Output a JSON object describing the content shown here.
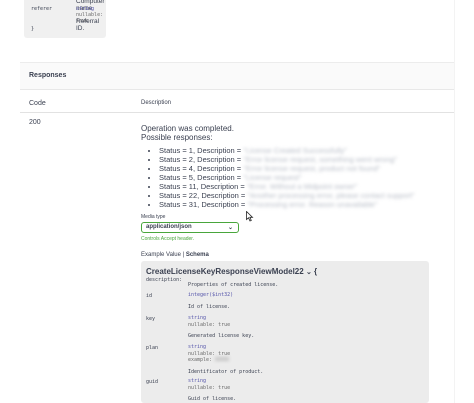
{
  "top_fragment": {
    "line1": "Computer name.",
    "key2": "referer",
    "type2": "string",
    "nullable2": "nullable: true",
    "desc2": "Referral ID.",
    "closing": "}"
  },
  "responses": {
    "section_title": "Responses",
    "col_code": "Code",
    "col_description": "Description",
    "code": "200",
    "desc_line1": "Operation was completed.",
    "desc_line2": "Possible responses:",
    "statuses": [
      {
        "label": "Status = 1, Description = ",
        "hidden": "\"License Created Successfully\""
      },
      {
        "label": "Status = 2, Description = ",
        "hidden": "\"Error license request, something went wrong\""
      },
      {
        "label": "Status = 4, Description = ",
        "hidden": "\"Error license request, product not found\""
      },
      {
        "label": "Status = 5, Description = ",
        "hidden": "\"License request\""
      },
      {
        "label": "Status = 11, Description = ",
        "hidden": "\"Error. Without a Midpoint owner\""
      },
      {
        "label": "Status = 22, Description = ",
        "hidden": "\"Another processing error, please contact support\""
      },
      {
        "label": "Status = 31, Description = ",
        "hidden": "\"Processing error. Reason unavailable\""
      }
    ],
    "media_type_label": "Media type",
    "media_type_value": "application/json",
    "controls_accept": "Controls Accept header.",
    "example_value_tab": "Example Value",
    "tab_separator": "|",
    "schema_tab": "Schema"
  },
  "schema": {
    "model_name": "CreateLicenseKeyResponseViewModel22",
    "open_brace": "{",
    "description_key": "description:",
    "description_val": "Properties of created license.",
    "fields": [
      {
        "key": "id",
        "type": "integer($int32)",
        "nullable": "",
        "example": "",
        "desc": "Id of license."
      },
      {
        "key": "key",
        "type": "string",
        "nullable": "nullable: true",
        "example": "",
        "desc": "Generated license key."
      },
      {
        "key": "plan",
        "type": "string",
        "nullable": "nullable: true",
        "example": "example: ",
        "desc": "Identificator of product."
      },
      {
        "key": "guid",
        "type": "string",
        "nullable": "nullable: true",
        "example": "",
        "desc": "Guid of license."
      }
    ]
  },
  "colors": {
    "accent_green": "#49a63c",
    "text": "#3b4151",
    "panel_gray": "#ececec"
  },
  "icons": [
    "chevron-down-icon",
    "mouse-cursor-icon"
  ]
}
